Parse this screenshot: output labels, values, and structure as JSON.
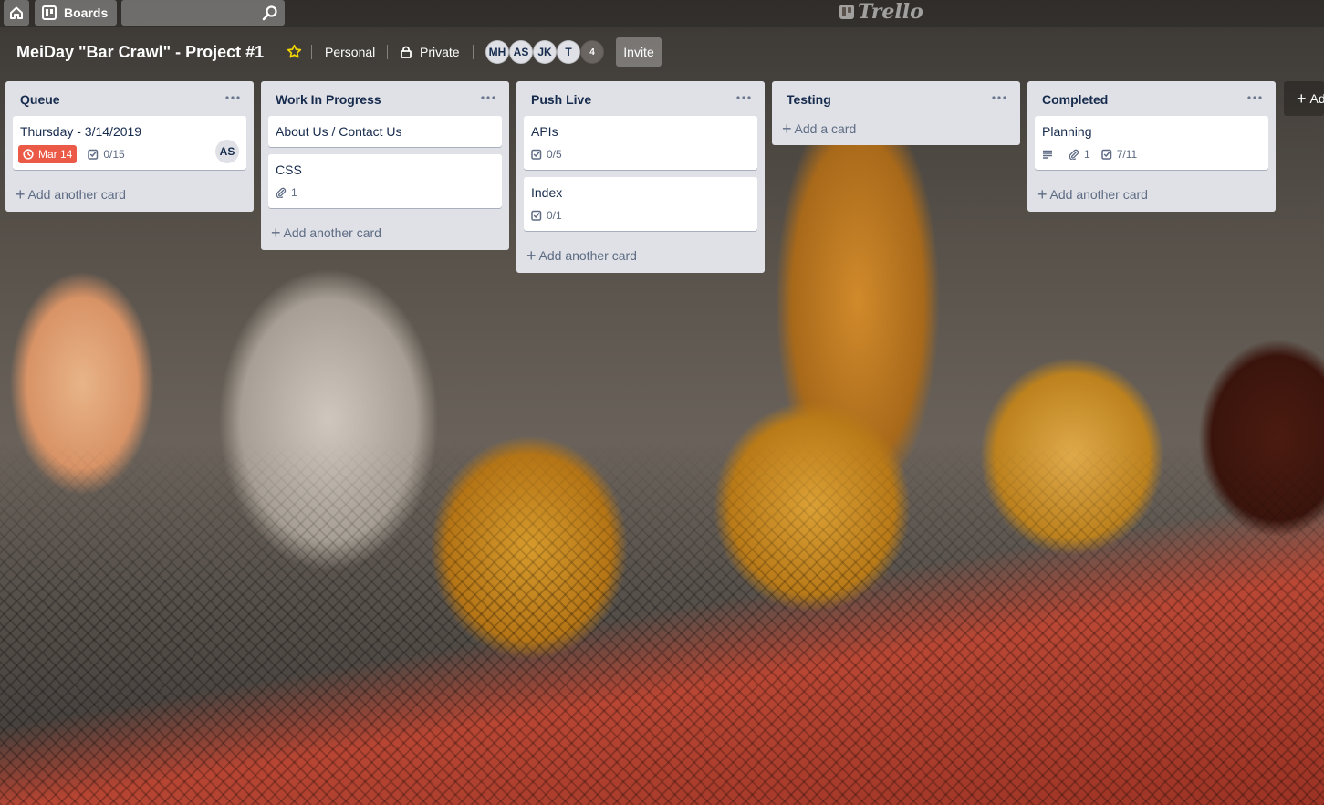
{
  "nav": {
    "home_icon": "home-icon",
    "boards_label": "Boards",
    "search_placeholder": "",
    "logo_text": "Trello"
  },
  "board": {
    "title": "MeiDay \"Bar Crawl\" - Project #1",
    "team": "Personal",
    "visibility": "Private",
    "members": [
      "MH",
      "AS",
      "JK",
      "T"
    ],
    "member_count": "4",
    "invite_label": "Invite"
  },
  "lists": [
    {
      "title": "Queue",
      "cards": [
        {
          "title": "Thursday - 3/14/2019",
          "due": "Mar 14",
          "checklist": "0/15",
          "member": "AS"
        }
      ],
      "add_label": "Add another card"
    },
    {
      "title": "Work In Progress",
      "cards": [
        {
          "title": "About Us / Contact Us"
        },
        {
          "title": "CSS",
          "attachments": "1"
        }
      ],
      "add_label": "Add another card"
    },
    {
      "title": "Push Live",
      "cards": [
        {
          "title": "APIs",
          "checklist": "0/5"
        },
        {
          "title": "Index",
          "checklist": "0/1"
        }
      ],
      "add_label": "Add another card"
    },
    {
      "title": "Testing",
      "cards": [],
      "add_label": "Add a card"
    },
    {
      "title": "Completed",
      "cards": [
        {
          "title": "Planning",
          "attachments": "1",
          "checklist": "7/11"
        }
      ],
      "add_label": "Add another card"
    }
  ],
  "add_list_label": "Add another list",
  "colors": {
    "list_bg": "#dfe1e6",
    "due_red": "#eb5a46",
    "star_yellow": "#f2d600"
  }
}
